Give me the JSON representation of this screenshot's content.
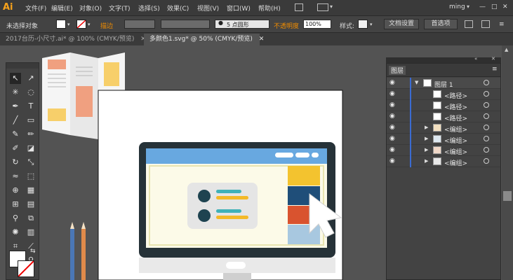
{
  "app": {
    "logo": "Ai",
    "user": "ming",
    "minimize": "—",
    "maximize": "□",
    "close": "✕"
  },
  "menu": [
    "文件(F)",
    "编辑(E)",
    "对象(O)",
    "文字(T)",
    "选择(S)",
    "效果(C)",
    "视图(V)",
    "窗口(W)",
    "帮助(H)"
  ],
  "control": {
    "selection": "未选择对象",
    "stroke_label": "描边",
    "brush": "5 点圆形",
    "opacity_label": "不透明度",
    "opacity_value": "100%",
    "style_label": "样式:",
    "doc_setup": "文档设置",
    "preferences": "首选项"
  },
  "tabs": [
    {
      "label": "2017台历-小尺寸.ai* @ 100% (CMYK/预览)",
      "close": "✕"
    },
    {
      "label": "多颜色1.svg* @ 50% (CMYK/预览)",
      "close": "✕"
    }
  ],
  "layers": {
    "title": "图层",
    "rows": [
      {
        "name": "图层 1",
        "expand": "▼"
      },
      {
        "name": "<路径>",
        "expand": ""
      },
      {
        "name": "<路径>",
        "expand": ""
      },
      {
        "name": "<路径>",
        "expand": ""
      },
      {
        "name": "<编组>",
        "expand": "▶"
      },
      {
        "name": "<编组>",
        "expand": "▶"
      },
      {
        "name": "<编组>",
        "expand": "▶"
      },
      {
        "name": "<编组>",
        "expand": "▶"
      }
    ]
  },
  "colors": {
    "ai_orange": "#f7a21b",
    "stroke_orange": "#f08c00",
    "layer_blue": "#3b6bd1"
  }
}
